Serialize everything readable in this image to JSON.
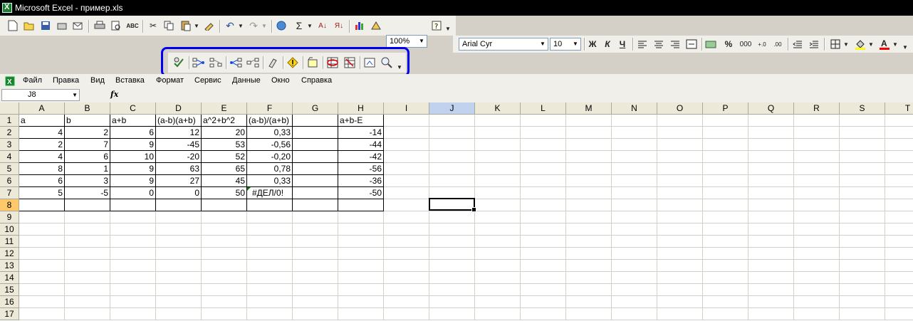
{
  "window": {
    "title": "Microsoft Excel - пример.xls"
  },
  "toolbar": {
    "zoom": "100%",
    "font_name": "Arial Cyr",
    "font_size": "10",
    "bold": "Ж",
    "italic": "К",
    "underline": "Ч",
    "percent": "%",
    "thousands": "000"
  },
  "menu": [
    "Файл",
    "Правка",
    "Вид",
    "Вставка",
    "Формат",
    "Сервис",
    "Данные",
    "Окно",
    "Справка"
  ],
  "formula_bar": {
    "name_box": "J8",
    "fx": "fx",
    "formula": ""
  },
  "grid": {
    "columns": [
      "A",
      "B",
      "C",
      "D",
      "E",
      "F",
      "G",
      "H",
      "I",
      "J",
      "K",
      "L",
      "M",
      "N",
      "O",
      "P",
      "Q",
      "R",
      "S",
      "T"
    ],
    "rows": [
      "1",
      "2",
      "3",
      "4",
      "5",
      "6",
      "7",
      "8",
      "9",
      "10",
      "11",
      "12",
      "13",
      "14",
      "15",
      "16",
      "17"
    ],
    "selected_col": "J",
    "selected_row": "8",
    "cells": [
      [
        "a",
        "b",
        "a+b",
        "(a-b)(a+b)",
        "a^2+b^2",
        "(a-b)/(a+b)",
        "",
        "a+b-E"
      ],
      [
        "4",
        "2",
        "6",
        "12",
        "20",
        "0,33",
        "",
        "-14"
      ],
      [
        "2",
        "7",
        "9",
        "-45",
        "53",
        "-0,56",
        "",
        "-44"
      ],
      [
        "4",
        "6",
        "10",
        "-20",
        "52",
        "-0,20",
        "",
        "-42"
      ],
      [
        "8",
        "1",
        "9",
        "63",
        "65",
        "0,78",
        "",
        "-56"
      ],
      [
        "6",
        "3",
        "9",
        "27",
        "45",
        "0,33",
        "",
        "-36"
      ],
      [
        "5",
        "-5",
        "0",
        "0",
        "50",
        "#ДЕЛ/0!",
        "",
        "-50"
      ],
      [
        "",
        "",
        "",
        "",
        "",
        "",
        "",
        ""
      ]
    ]
  },
  "colors": {
    "highlight": "#0000ee",
    "title_bg": "#000000"
  }
}
